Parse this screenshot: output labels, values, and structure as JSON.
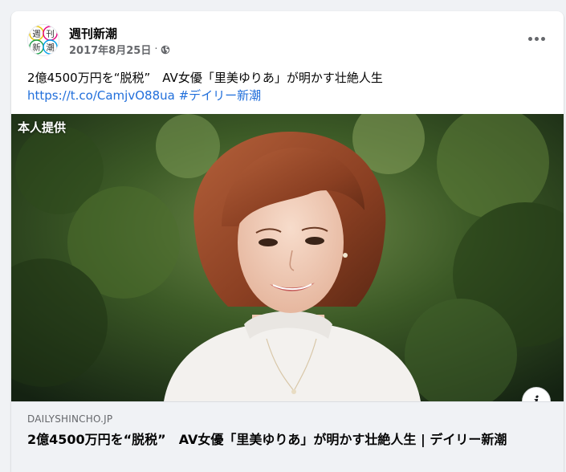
{
  "post": {
    "page_name": "週刊新潮",
    "date": "2017年8月25日",
    "separator": "·",
    "text_line1": "2億4500万円を“脱税”　AV女優「里美ゆりあ」が明かす壮絶人生",
    "url": "https://t.co/CamjvO88ua",
    "hashtag": "#デイリー新潮"
  },
  "avatar": {
    "chars": [
      "週",
      "刊",
      "新",
      "潮"
    ],
    "colors": [
      "#e8c400",
      "#e4007f",
      "#1fa14a",
      "#00a0e9"
    ]
  },
  "image": {
    "caption": "本人提供"
  },
  "link_preview": {
    "domain": "DAILYSHINCHO.JP",
    "title": "2億4500万円を“脱税”　AV女優「里美ゆりあ」が明かす壮絶人生 | デイリー新潮"
  },
  "colors": {
    "link": "#216fdb",
    "secondary_text": "#65676b",
    "preview_bg": "#f0f2f5"
  },
  "icons": [
    "globe-icon",
    "more-icon",
    "info-icon"
  ]
}
